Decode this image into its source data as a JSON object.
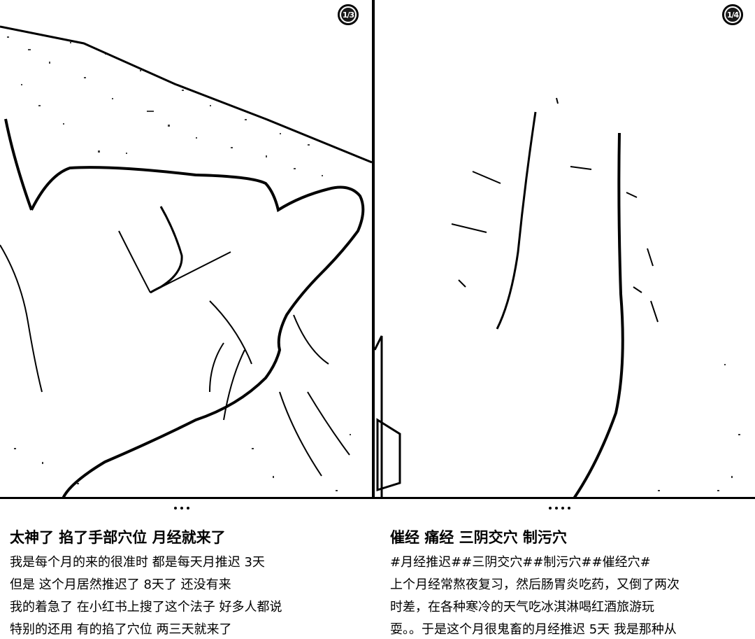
{
  "cards": [
    {
      "badge": "1/3",
      "title": "太神了 掐了手部穴位 月经就来了",
      "lines": [
        "我是每个月的来的很准时  都是每天月推迟 3天",
        "但是 这个月居然推迟了 8天了  还没有来",
        "我的着急了    在小红书上搜了这个法子  好多人都说",
        "特别的还用 有的掐了穴位 两三天就来了"
      ]
    },
    {
      "badge": "1/4",
      "title": "催经 痛经 三阴交穴 制污穴",
      "lines": [
        "#月经推迟##三阴交穴##制污穴##催经穴#",
        "上个月经常熬夜复习，然后肠胃炎吃药，又倒了两次",
        "时差，在各种寒冷的天气吃冰淇淋喝红酒旅游玩",
        "耍。。于是这个月很鬼畜的月经推迟 5天 我是那种从"
      ]
    }
  ]
}
